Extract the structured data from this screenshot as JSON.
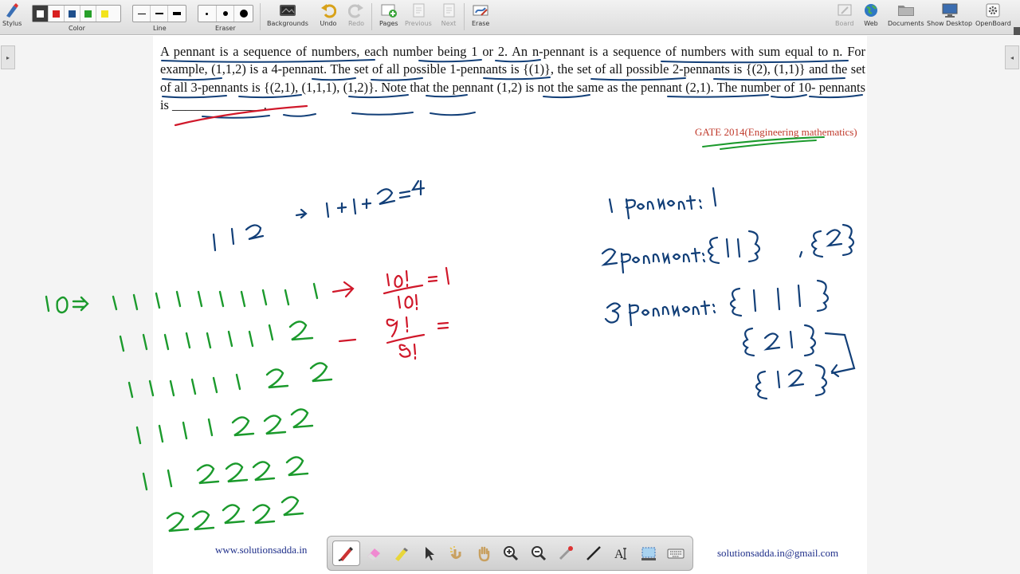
{
  "toolbar": {
    "stylus": "Stylus",
    "color": "Color",
    "line": "Line",
    "eraser": "Eraser",
    "backgrounds": "Backgrounds",
    "undo": "Undo",
    "redo": "Redo",
    "pages": "Pages",
    "previous": "Previous",
    "next": "Next",
    "erase": "Erase",
    "board": "Board",
    "web": "Web",
    "documents": "Documents",
    "show_desktop": "Show Desktop",
    "openboard": "OpenBoard",
    "colors": [
      "#000000",
      "#d81e1e",
      "#1f4f8c",
      "#27a02a",
      "#f2e31b"
    ]
  },
  "question": {
    "text": "A pennant is a sequence of numbers, each number being 1 or 2. An n-pennant is a sequence of numbers with sum equal to n. For example, (1,1,2) is a 4-pennant. The set of all possible 1-pennants is {(1)}, the set of all possible 2-pennants is {(2), (1,1)} and the set of all 3-pennants is {(2,1), (1,1,1), (1,2)}. Note that the pennant (1,2) is not the same as the pennant (2,1). The number of 10- pennants is ______________.",
    "source": "GATE 2014(Engineering mathematics)"
  },
  "handwriting": {
    "blue_example": "1 1 2  →  1+1+2=4",
    "one_pennant": "1 pennant : 1",
    "two_pennant": "2 pennant : {1 1} , {2}",
    "three_pennant": "3 pennant : {1 1 1} {2 1} {1 2}",
    "ten_label": "10 ⇒",
    "green_rows": [
      "1 1 1 1 1 1 1 1 1 1",
      "1 1 1 1 1 1 1 1 2",
      "1 1 1 1 1 1 2 2",
      "1 1 1 1 2 2 2",
      "1 1 2 2 2 2",
      "2 2 2 2 2"
    ],
    "red_fraction_1": "10! / 10! = 1",
    "red_fraction_2": "9! / 8! ="
  },
  "footer": {
    "website": "www.solutionsadda.in",
    "email": "solutionsadda.in@gmail.com"
  },
  "colors": {
    "ink_blue": "#123f78",
    "ink_green": "#1b9a2c",
    "ink_red": "#d0182a",
    "source_red": "#c0392b"
  },
  "palette_tools": [
    "pen-icon",
    "eraser-icon",
    "highlighter-icon",
    "select-icon",
    "laser-pointer-icon",
    "hand-icon",
    "zoom-in-icon",
    "zoom-out-icon",
    "pointer-icon",
    "line-icon",
    "text-icon",
    "capture-icon",
    "keyboard-icon"
  ]
}
